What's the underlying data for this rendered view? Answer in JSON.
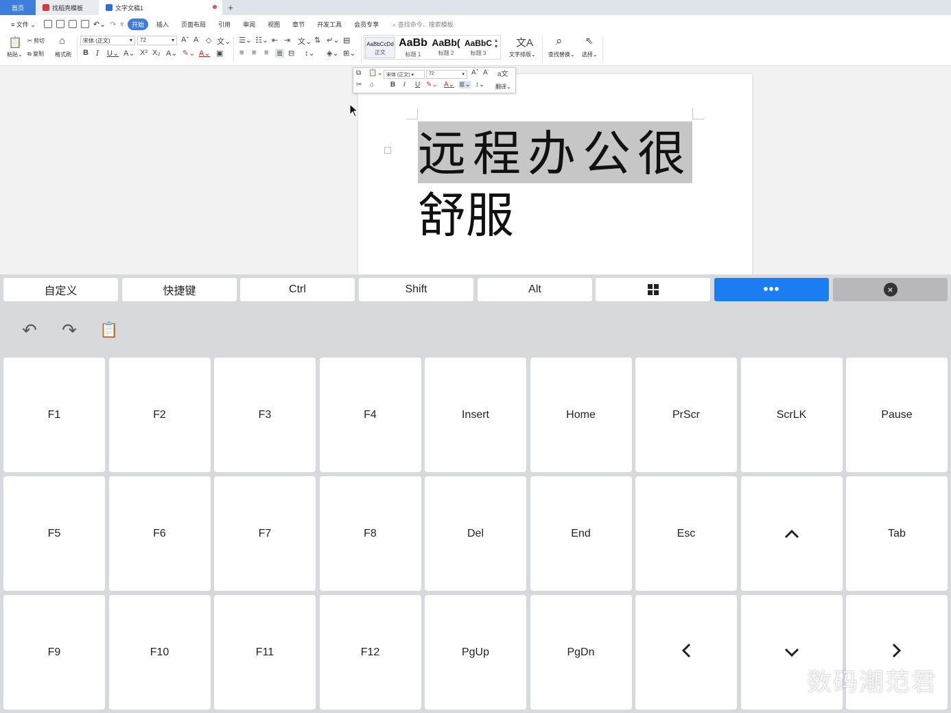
{
  "tabs": {
    "home": "首页",
    "template": "找稻壳模板",
    "document": "文字文稿1",
    "new_tab": "+"
  },
  "menu": {
    "file": "文件",
    "items": [
      "开始",
      "插入",
      "页面布局",
      "引用",
      "审阅",
      "视图",
      "章节",
      "开发工具",
      "会员专享"
    ],
    "search_placeholder": "查找命令、搜索模板"
  },
  "ribbon": {
    "paste": "粘贴",
    "cut": "剪切",
    "copy": "复制",
    "format_painter": "格式刷",
    "font_name": "宋体 (正文)",
    "font_size": "72",
    "styles": [
      {
        "preview": "AaBbCcDd",
        "label": "正文"
      },
      {
        "preview": "AaBb",
        "label": "标题 1"
      },
      {
        "preview": "AaBb(",
        "label": "标题 2"
      },
      {
        "preview": "AaBbC",
        "label": "标题 3"
      }
    ],
    "text_layout": "文字排版",
    "find_replace": "查找替换",
    "select": "选择"
  },
  "mini_toolbar": {
    "font_name": "宋体 (正文)",
    "font_size": "72",
    "translate": "翻译"
  },
  "document": {
    "line1": "远程办公很",
    "line2": "舒服"
  },
  "shortcut_bar": {
    "custom": "自定义",
    "hotkeys": "快捷键",
    "ctrl": "Ctrl",
    "shift": "Shift",
    "alt": "Alt",
    "windows_icon": "windows-icon",
    "more": "•••",
    "close_icon": "close-icon"
  },
  "keys": {
    "row1": [
      "F1",
      "F2",
      "F3",
      "F4",
      "Insert",
      "Home",
      "PrScr",
      "ScrLK",
      "Pause"
    ],
    "row2": [
      "F5",
      "F6",
      "F7",
      "F8",
      "Del",
      "End",
      "Esc",
      "^",
      "Tab"
    ],
    "row3": [
      "F9",
      "F10",
      "F11",
      "F12",
      "PgUp",
      "PgDn",
      "<",
      "v",
      ">"
    ]
  },
  "watermark": "数码潮范君",
  "colors": {
    "accent_blue": "#1a7df2",
    "tab_blue": "#3d7ddc",
    "panel_bg": "#d8d9dd",
    "selection_grey": "#c6c6c6"
  }
}
